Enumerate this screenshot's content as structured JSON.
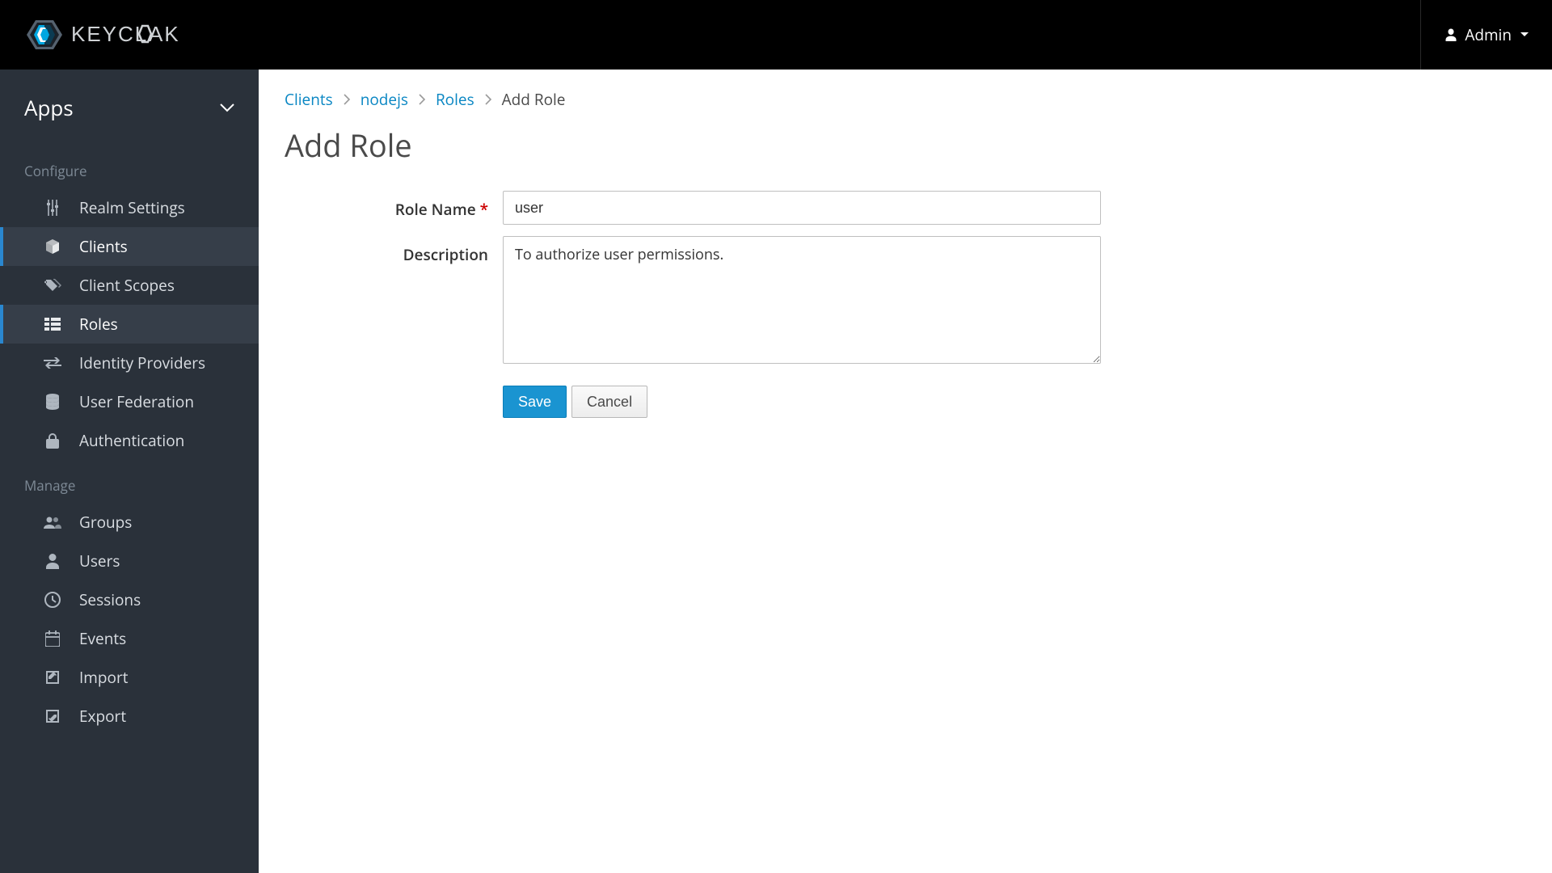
{
  "brand": "KEYCLOAK",
  "topbar": {
    "user_label": "Admin"
  },
  "sidebar": {
    "realm_name": "Apps",
    "section_configure": "Configure",
    "section_manage": "Manage",
    "configure": [
      {
        "id": "realm-settings",
        "label": "Realm Settings",
        "icon": "sliders"
      },
      {
        "id": "clients",
        "label": "Clients",
        "icon": "cube"
      },
      {
        "id": "client-scopes",
        "label": "Client Scopes",
        "icon": "tags"
      },
      {
        "id": "roles",
        "label": "Roles",
        "icon": "list"
      },
      {
        "id": "identity-providers",
        "label": "Identity Providers",
        "icon": "link"
      },
      {
        "id": "user-federation",
        "label": "User Federation",
        "icon": "database"
      },
      {
        "id": "authentication",
        "label": "Authentication",
        "icon": "lock"
      }
    ],
    "manage": [
      {
        "id": "groups",
        "label": "Groups",
        "icon": "group"
      },
      {
        "id": "users",
        "label": "Users",
        "icon": "user"
      },
      {
        "id": "sessions",
        "label": "Sessions",
        "icon": "clock"
      },
      {
        "id": "events",
        "label": "Events",
        "icon": "calendar"
      },
      {
        "id": "import",
        "label": "Import",
        "icon": "import"
      },
      {
        "id": "export",
        "label": "Export",
        "icon": "export"
      }
    ]
  },
  "breadcrumb": {
    "items": [
      {
        "label": "Clients",
        "link": true
      },
      {
        "label": "nodejs",
        "link": true
      },
      {
        "label": "Roles",
        "link": true
      },
      {
        "label": "Add Role",
        "link": false
      }
    ]
  },
  "page": {
    "title": "Add Role",
    "form": {
      "role_name_label": "Role Name",
      "role_name_value": "user",
      "description_label": "Description",
      "description_value": "To authorize user permissions.",
      "save_label": "Save",
      "cancel_label": "Cancel"
    }
  }
}
